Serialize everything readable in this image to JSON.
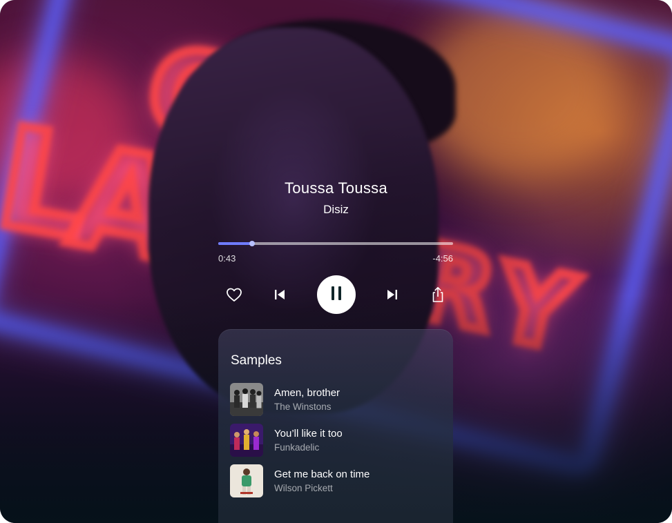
{
  "track": {
    "title": "Toussa Toussa",
    "artist": "Disiz"
  },
  "playback": {
    "elapsed": "0:43",
    "remaining": "-4:56",
    "progress_fraction": 0.145,
    "state": "playing"
  },
  "controls": {
    "like_icon": "heart-icon",
    "previous_icon": "skip-previous-icon",
    "play_pause_icon": "pause-icon",
    "next_icon": "skip-next-icon",
    "share_icon": "share-icon"
  },
  "samples": {
    "heading": "Samples",
    "items": [
      {
        "title": "Amen, brother",
        "artist": "The Winstons"
      },
      {
        "title": "You’ll like it too",
        "artist": "Funkadelic"
      },
      {
        "title": "Get me back on time",
        "artist": "Wilson Pickett"
      }
    ]
  },
  "colors": {
    "accent": "#6f7cff",
    "panel": "#1c2632",
    "text": "#ffffff"
  }
}
